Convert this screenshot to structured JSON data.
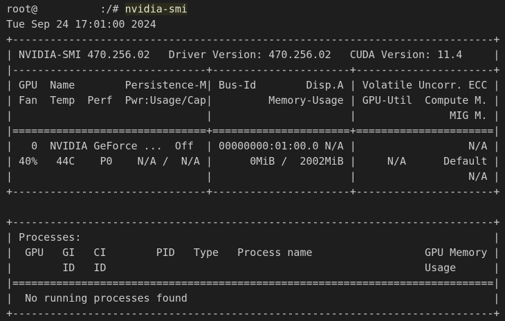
{
  "prompt": {
    "user": "root@",
    "host_gap": "          ",
    "path": ":/# ",
    "command": "nvidia-smi"
  },
  "output_lines": [
    "Tue Sep 24 17:01:00 2024",
    "+-----------------------------------------------------------------------------+",
    "| NVIDIA-SMI 470.256.02   Driver Version: 470.256.02   CUDA Version: 11.4     |",
    "|-------------------------------+----------------------+----------------------+",
    "| GPU  Name        Persistence-M| Bus-Id        Disp.A | Volatile Uncorr. ECC |",
    "| Fan  Temp  Perf  Pwr:Usage/Cap|         Memory-Usage | GPU-Util  Compute M. |",
    "|                               |                      |               MIG M. |",
    "|===============================+======================+======================|",
    "|   0  NVIDIA GeForce ...  Off  | 00000000:01:00.0 N/A |                  N/A |",
    "| 40%   44C    P0    N/A /  N/A |      0MiB /  2002MiB |     N/A      Default |",
    "|                               |                      |                  N/A |",
    "+-------------------------------+----------------------+----------------------+",
    "",
    "+-----------------------------------------------------------------------------+",
    "| Processes:                                                                  |",
    "|  GPU   GI   CI        PID   Type   Process name                  GPU Memory |",
    "|        ID   ID                                                   Usage      |",
    "|=============================================================================|",
    "|  No running processes found                                                 |",
    "+-----------------------------------------------------------------------------+"
  ]
}
